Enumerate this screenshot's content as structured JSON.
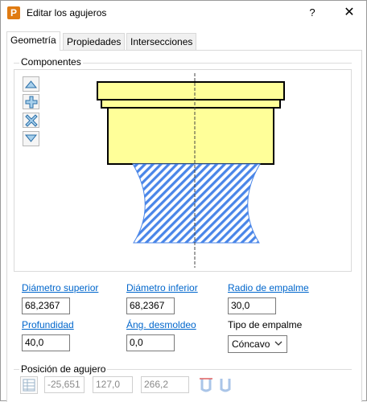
{
  "window": {
    "title": "Editar los agujeros",
    "help": "?",
    "close": "✕",
    "app_icon": "P"
  },
  "tabs": [
    {
      "label": "Geometría",
      "active": true
    },
    {
      "label": "Propiedades",
      "active": false
    },
    {
      "label": "Intersecciones",
      "active": false
    }
  ],
  "components": {
    "label": "Componentes"
  },
  "side_buttons": [
    "move-up-icon",
    "add-icon",
    "delete-icon",
    "move-down-icon"
  ],
  "fields": {
    "diametro_superior": {
      "label": "Diámetro superior",
      "value": "68,2367"
    },
    "diametro_inferior": {
      "label": "Diámetro inferior",
      "value": "68,2367"
    },
    "radio_empalme": {
      "label": "Radio de empalme",
      "value": "30,0"
    },
    "profundidad": {
      "label": "Profundidad",
      "value": "40,0"
    },
    "ang_desmoldeo": {
      "label": "Áng. desmoldeo",
      "value": "0,0"
    },
    "tipo_empalme": {
      "label": "Tipo de empalme",
      "value": "Cóncavo"
    }
  },
  "position": {
    "label": "Posición de agujero",
    "x": "-25,651",
    "y": "127,0",
    "z": "266,2"
  },
  "colors": {
    "shape_fill": "#ffff99",
    "hatch": "#4a86e8",
    "link": "#0066cc",
    "app_icon": "#e07b12"
  }
}
